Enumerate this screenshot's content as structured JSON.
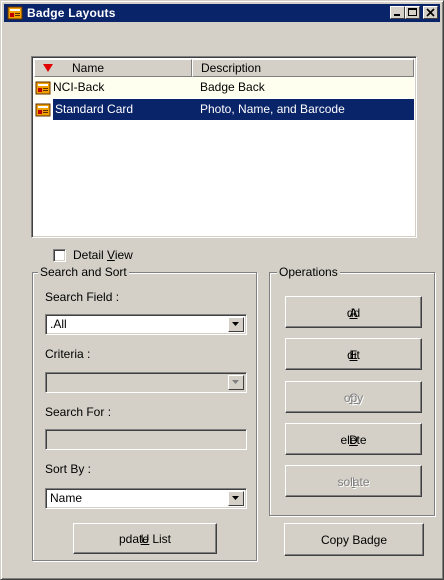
{
  "window": {
    "title": "Badge Layouts"
  },
  "list": {
    "columns": [
      "Name",
      "Description"
    ],
    "rows": [
      {
        "name": "NCI-Back",
        "description": "Badge Back",
        "selected": false
      },
      {
        "name": "Standard Card",
        "description": "Photo, Name, and Barcode",
        "selected": true
      }
    ]
  },
  "detail_view": {
    "label_pre": "Detail ",
    "label_key": "V",
    "label_post": "iew",
    "checked": false
  },
  "search": {
    "group_title": "Search and Sort",
    "search_field_label": "Search Field :",
    "search_field_value": ".All",
    "criteria_label": "Criteria :",
    "criteria_value": "",
    "search_for_label": "Search For :",
    "search_for_value": "",
    "sort_by_label": "Sort By :",
    "sort_by_value": "Name",
    "update_key": "U",
    "update_rest": "pdate List"
  },
  "operations": {
    "group_title": "Operations",
    "add_key": "A",
    "add_rest": "dd",
    "edit_key": "E",
    "edit_rest": "dit",
    "copy_key": "C",
    "copy_rest": "opy",
    "delete_key": "D",
    "delete_rest": "elete",
    "isolate_key": "I",
    "isolate_rest": "solate",
    "copy_badge_label": "Copy Badge"
  },
  "colors": {
    "title_bar": "#0a246a",
    "selection": "#0a246a",
    "face": "#d4d0c8",
    "sort_arrow": "#e00000"
  }
}
